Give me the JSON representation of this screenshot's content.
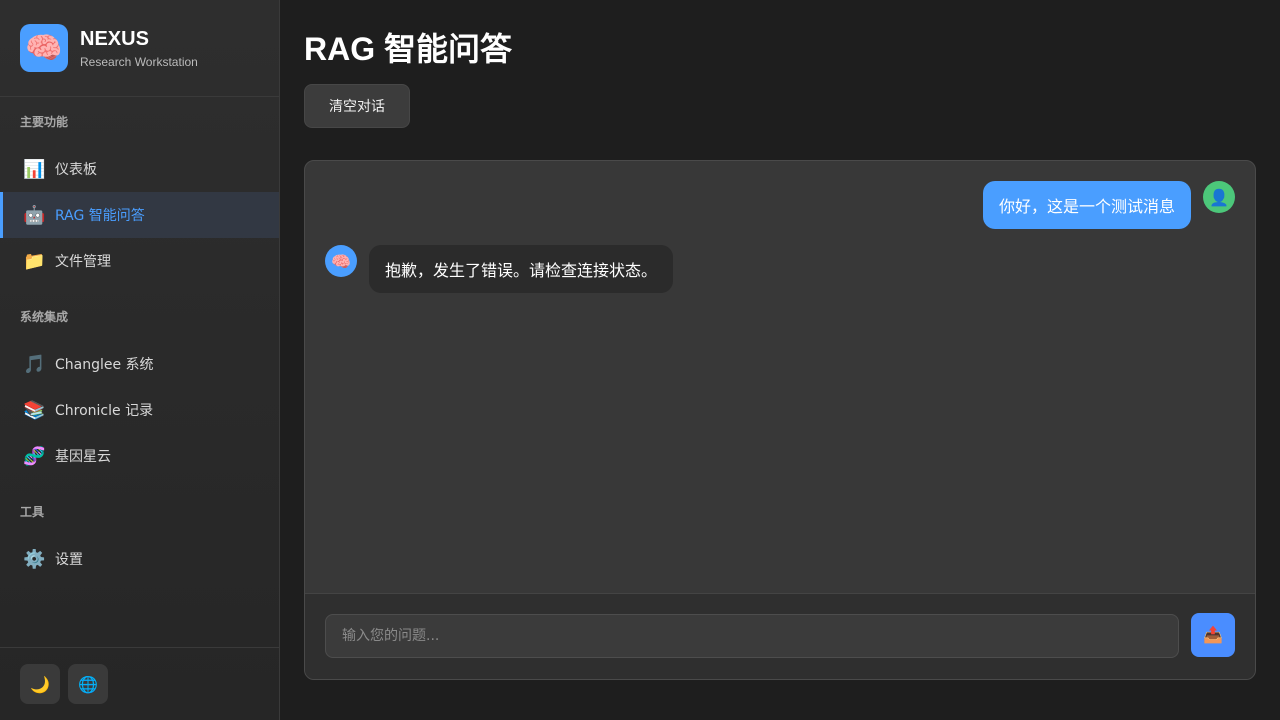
{
  "brand": {
    "icon": "brain-icon",
    "title": "NEXUS",
    "subtitle": "Research Workstation"
  },
  "sidebar": {
    "sections": [
      {
        "label": "主要功能",
        "items": [
          {
            "icon": "📊",
            "icon_name": "bar-chart-icon",
            "label": "仪表板"
          },
          {
            "icon": "🤖",
            "icon_name": "robot-icon",
            "label": "RAG 智能问答",
            "active": true
          },
          {
            "icon": "📁",
            "icon_name": "folder-icon",
            "label": "文件管理"
          }
        ]
      },
      {
        "label": "系统集成",
        "items": [
          {
            "icon": "🎵",
            "icon_name": "music-note-icon",
            "label": "Changlee 系统"
          },
          {
            "icon": "📚",
            "icon_name": "books-icon",
            "label": "Chronicle 记录"
          },
          {
            "icon": "🧬",
            "icon_name": "dna-icon",
            "label": "基因星云"
          }
        ]
      },
      {
        "label": "工具",
        "items": [
          {
            "icon": "⚙️",
            "icon_name": "gear-icon",
            "label": "设置"
          }
        ]
      }
    ],
    "footer": {
      "theme_icon": "🌙",
      "language_icon": "🌐"
    }
  },
  "main": {
    "title": "RAG 智能问答",
    "clear_label": "清空对话",
    "messages": [
      {
        "role": "user",
        "avatar": "👤",
        "text": "你好，这是一个测试消息"
      },
      {
        "role": "assistant",
        "avatar": "🧠",
        "text": "抱歉，发生了错误。请检查连接状态。"
      }
    ],
    "input_placeholder": "输入您的问题...",
    "send_icon": "📤"
  },
  "colors": {
    "accent": "#4a9eff",
    "user_avatar": "#4cc77a",
    "background": "#1e1e1e"
  }
}
